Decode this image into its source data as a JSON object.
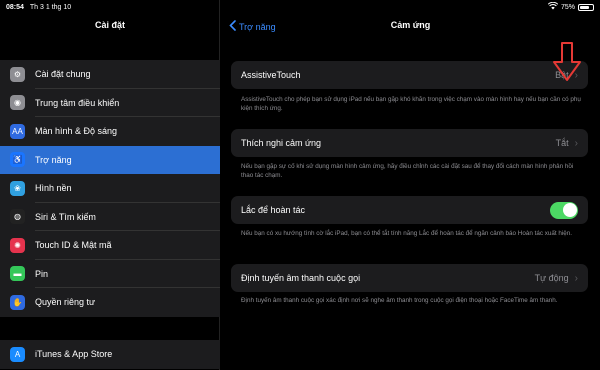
{
  "status": {
    "time": "08:54",
    "date": "Th 3 1 thg 10",
    "battery": "75%",
    "battery_level": 0.75
  },
  "sidebar": {
    "title": "Cài đặt",
    "groups": [
      [
        {
          "label": "Cài đặt chung",
          "icon": "gear-icon",
          "color": "#8e8e93",
          "glyph": "⚙"
        },
        {
          "label": "Trung tâm điều khiển",
          "icon": "control-center-icon",
          "color": "#8e8e93",
          "glyph": "◉"
        },
        {
          "label": "Màn hình & Độ sáng",
          "icon": "display-icon",
          "color": "#2f6ae0",
          "glyph": "AA"
        },
        {
          "label": "Trợ năng",
          "icon": "accessibility-icon",
          "color": "#1a75ff",
          "glyph": "♿",
          "active": true
        },
        {
          "label": "Hình nền",
          "icon": "wallpaper-icon",
          "color": "#30a0e0",
          "glyph": "❀"
        },
        {
          "label": "Siri & Tìm kiếm",
          "icon": "siri-icon",
          "color": "#222",
          "glyph": "◍"
        },
        {
          "label": "Touch ID & Mật mã",
          "icon": "fingerprint-icon",
          "color": "#e5334d",
          "glyph": "✺"
        },
        {
          "label": "Pin",
          "icon": "battery-icon",
          "color": "#34c759",
          "glyph": "▬"
        },
        {
          "label": "Quyền riêng tư",
          "icon": "hand-icon",
          "color": "#2f6ae0",
          "glyph": "✋"
        }
      ],
      [
        {
          "label": "iTunes & App Store",
          "icon": "app-store-icon",
          "color": "#1a8cff",
          "glyph": "A"
        }
      ]
    ]
  },
  "main": {
    "back_label": "Trợ năng",
    "title": "Cảm ứng",
    "cells": [
      {
        "label": "AssistiveTouch",
        "value": "Bật",
        "footnote": "AssistiveTouch cho phép bạn sử dụng iPad nếu bạn gặp khó khăn trong việc chạm vào màn hình hay nếu bạn cần có phụ kiện thích ứng."
      },
      {
        "label": "Thích nghi cảm ứng",
        "value": "Tắt",
        "footnote": "Nếu bạn gặp sự cố khi sử dụng màn hình cảm ứng, hãy điều chỉnh các cài đặt sau để thay đổi cách màn hình phản hồi thao tác chạm."
      },
      {
        "label": "Lắc để hoàn tác",
        "toggle_on": true,
        "footnote": "Nếu bạn có xu hướng tình cờ lắc iPad, bạn có thể tắt tính năng Lắc để hoàn tác để ngăn cảnh báo Hoàn tác xuất hiện."
      },
      {
        "label": "Định tuyến âm thanh cuộc gọi",
        "value": "Tự động",
        "footnote": "Định tuyến âm thanh cuộc gọi xác định nơi sẽ nghe âm thanh trong cuộc gọi điện thoại hoặc FaceTime âm thanh."
      }
    ]
  },
  "annotation": {
    "color": "#e53935"
  }
}
